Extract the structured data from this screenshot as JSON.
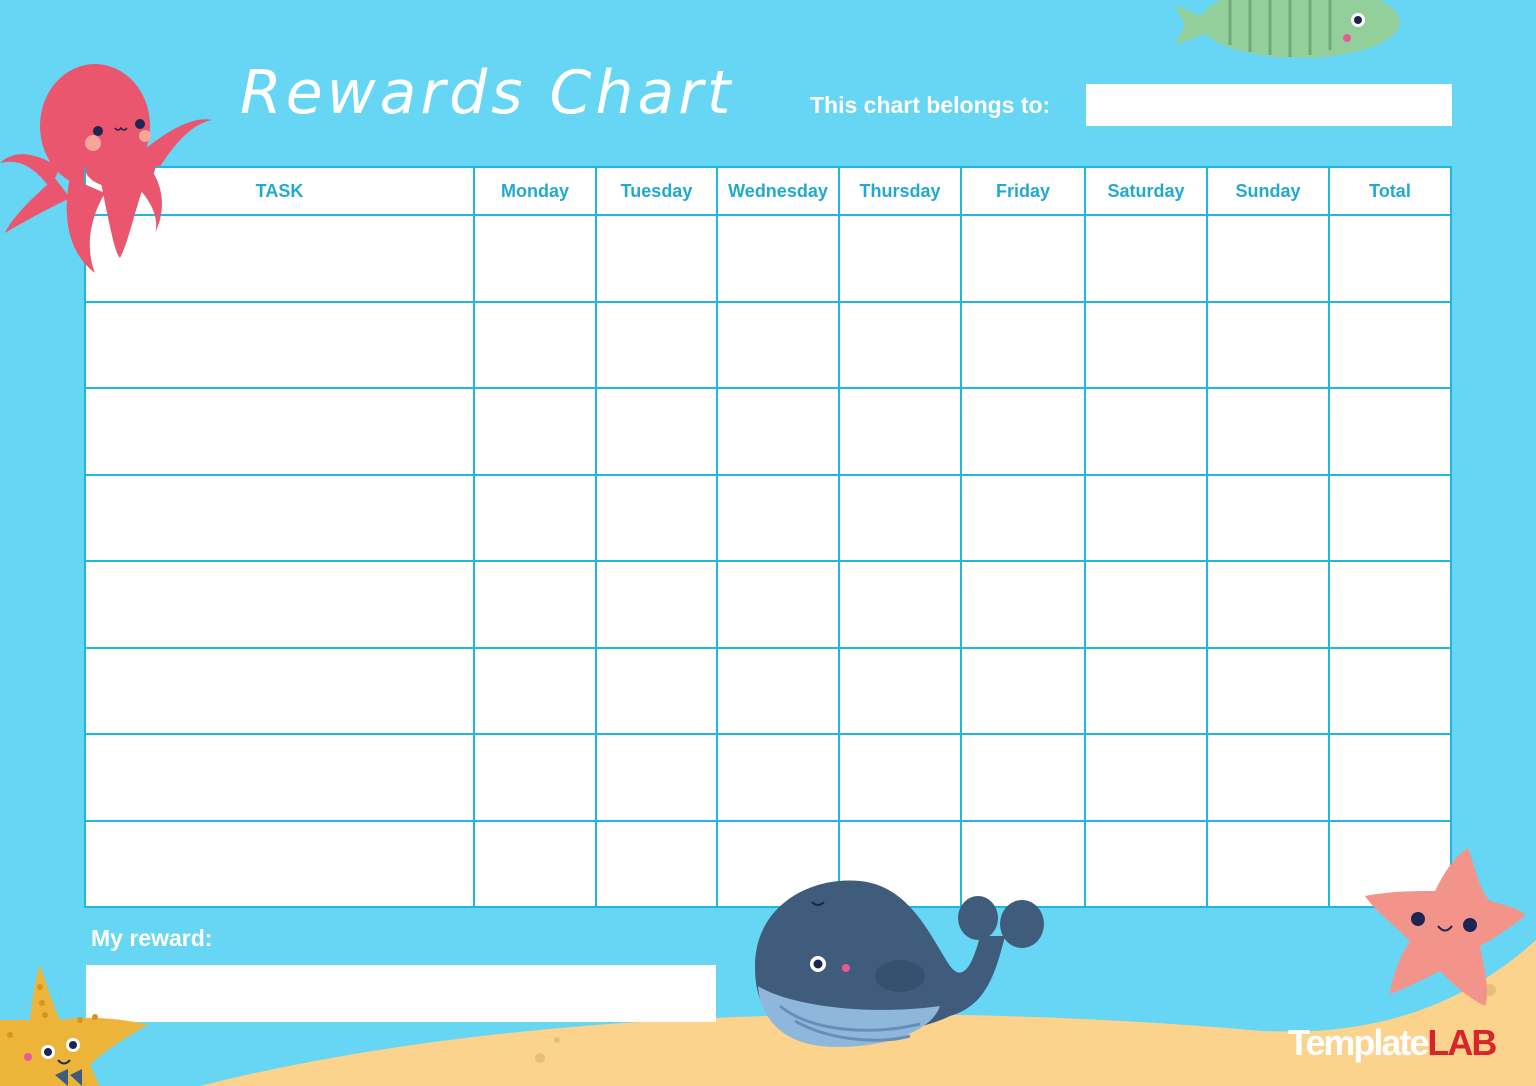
{
  "header": {
    "title": "Rewards Chart",
    "belongs_label": "This chart belongs to:",
    "belongs_value": ""
  },
  "table": {
    "columns": [
      "TASK",
      "Monday",
      "Tuesday",
      "Wednesday",
      "Thursday",
      "Friday",
      "Saturday",
      "Sunday",
      "Total"
    ],
    "rows": [
      [
        "",
        "",
        "",
        "",
        "",
        "",
        "",
        "",
        ""
      ],
      [
        "",
        "",
        "",
        "",
        "",
        "",
        "",
        "",
        ""
      ],
      [
        "",
        "",
        "",
        "",
        "",
        "",
        "",
        "",
        ""
      ],
      [
        "",
        "",
        "",
        "",
        "",
        "",
        "",
        "",
        ""
      ],
      [
        "",
        "",
        "",
        "",
        "",
        "",
        "",
        "",
        ""
      ],
      [
        "",
        "",
        "",
        "",
        "",
        "",
        "",
        "",
        ""
      ],
      [
        "",
        "",
        "",
        "",
        "",
        "",
        "",
        "",
        ""
      ],
      [
        "",
        "",
        "",
        "",
        "",
        "",
        "",
        "",
        ""
      ]
    ]
  },
  "reward": {
    "label": "My reward:",
    "value": ""
  },
  "decorations": [
    "octopus",
    "green-fish",
    "whale",
    "pink-starfish",
    "yellow-starfish",
    "sand"
  ],
  "watermark": {
    "part1": "Template",
    "part2": "LAB"
  },
  "colors": {
    "background": "#67d6f4",
    "grid": "#1fb7de",
    "header_text": "#22a9d3",
    "sand": "#fbd38d",
    "octopus": "#e9566d",
    "whale": "#3f5c7c",
    "fish": "#93cf9b",
    "pink_star": "#f3948a",
    "yellow_star": "#edb43a",
    "brand_red": "#d8242a"
  }
}
